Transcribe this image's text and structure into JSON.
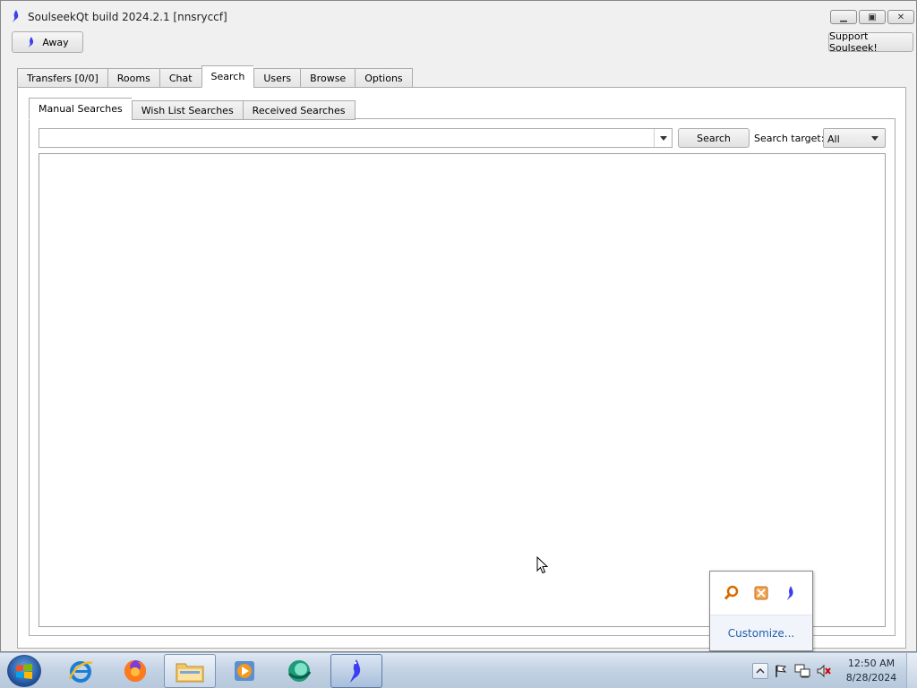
{
  "window": {
    "title": "SoulseekQt build 2024.2.1 [nnsryccf]",
    "away_label": "Away",
    "support_label": "Support Soulseek!"
  },
  "main_tabs": [
    {
      "label": "Transfers [0/0]",
      "active": false
    },
    {
      "label": "Rooms",
      "active": false
    },
    {
      "label": "Chat",
      "active": false
    },
    {
      "label": "Search",
      "active": true
    },
    {
      "label": "Users",
      "active": false
    },
    {
      "label": "Browse",
      "active": false
    },
    {
      "label": "Options",
      "active": false
    }
  ],
  "sub_tabs": [
    {
      "label": "Manual Searches",
      "active": true
    },
    {
      "label": "Wish List Searches",
      "active": false
    },
    {
      "label": "Received Searches",
      "active": false
    }
  ],
  "search": {
    "query": "",
    "button_label": "Search",
    "target_label": "Search target:",
    "target_value": "All"
  },
  "tray_popup": {
    "customize_label": "Customize...",
    "icons": [
      "search-magnifier-icon",
      "x-box-icon",
      "soulseek-bird-icon"
    ]
  },
  "taskbar": {
    "items": [
      "internet-explorer-icon",
      "firefox-icon",
      "file-explorer-icon",
      "media-player-icon",
      "browser-globe-icon",
      "soulseek-icon"
    ],
    "time": "12:50 AM",
    "date": "8/28/2024"
  },
  "colors": {
    "window_bg": "#f0f0f0",
    "link_blue": "#1e5fa8",
    "soulseek_blue": "#3b3ff0"
  }
}
